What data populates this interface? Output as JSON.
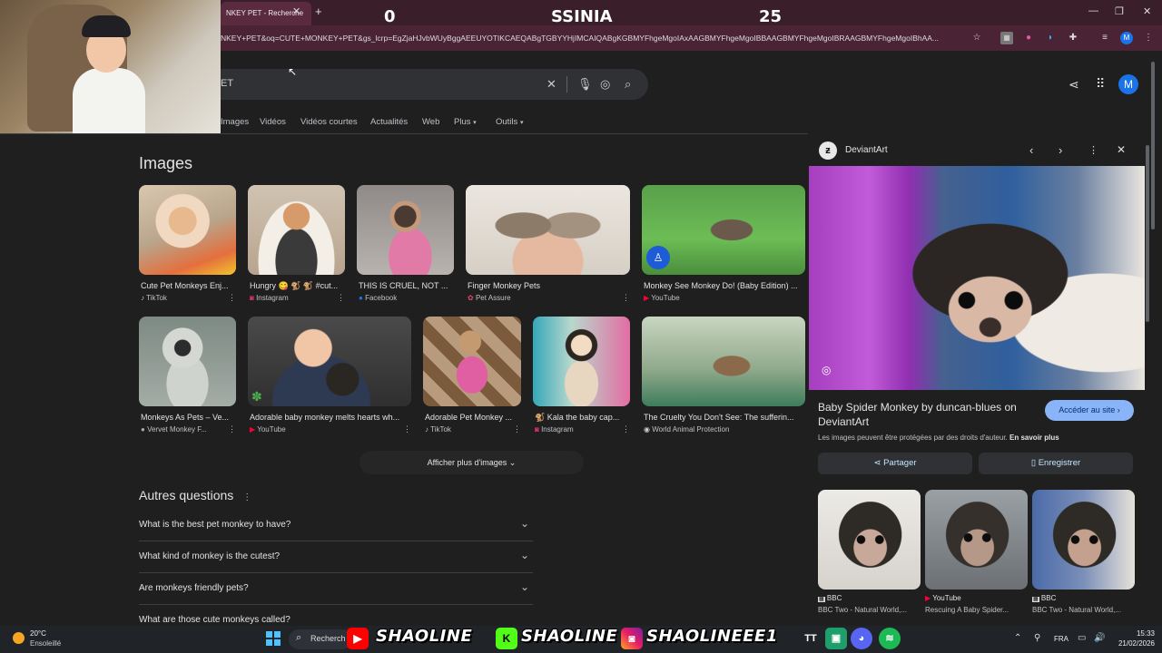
{
  "scoreboard": {
    "left": "0",
    "center": "SSINIA",
    "right": "25"
  },
  "browser": {
    "tab_title": "NKEY PET - Recherche",
    "url": "NKEY+PET&oq=CUTE+MONKEY+PET&gs_lcrp=EgZjaHJvbWUyBggAEEUYOTIKCAEQABgTGBYYHjIMCAIQABgKGBMYFhgeMgoIAxAAGBMYFhgeMgoIBBAAGBMYFhgeMgoIBRAAGBMYFhgeMgoIBhAA...",
    "close": "✕",
    "new_tab": "+",
    "win_min": "—",
    "win_max": "❐",
    "win_close": "✕"
  },
  "google": {
    "search_value": "ET",
    "filters": [
      "Images",
      "Vidéos",
      "Vidéos courtes",
      "Actualités",
      "Web",
      "Plus",
      "Outils"
    ],
    "avatar": "M"
  },
  "images": {
    "title": "Images",
    "more_label": "Afficher plus d'images",
    "items": [
      {
        "title": "Cute Pet Monkeys Enj...",
        "source": "TikTok"
      },
      {
        "title": "Hungry 😋 🐒 🐒 #cut...",
        "source": "Instagram"
      },
      {
        "title": "THIS IS CRUEL, NOT ...",
        "source": "Facebook"
      },
      {
        "title": "Finger Monkey Pets",
        "source": "Pet Assure"
      },
      {
        "title": "Monkey See Monkey Do! (Baby Edition) ...",
        "source": "YouTube"
      },
      {
        "title": "Monkeys As Pets – Ve...",
        "source": "Vervet Monkey F..."
      },
      {
        "title": "Adorable baby monkey melts hearts wh...",
        "source": "YouTube"
      },
      {
        "title": "Adorable Pet Monkey ...",
        "source": "TikTok"
      },
      {
        "title": "🐒 Kala the baby cap...",
        "source": "Instagram"
      },
      {
        "title": "The Cruelty You Don't See: The sufferin...",
        "source": "World Animal Protection"
      }
    ]
  },
  "questions": {
    "title": "Autres questions",
    "items": [
      "What is the best pet monkey to have?",
      "What kind of monkey is the cutest?",
      "Are monkeys friendly pets?",
      "What are those cute monkeys called?"
    ]
  },
  "panel": {
    "source": "DeviantArt",
    "title": "Baby Spider Monkey by duncan-blues on DeviantArt",
    "visit_label": "Accéder au site",
    "copyright": "Les images peuvent être protégées par des droits d'auteur.",
    "learn_more": "En savoir plus",
    "share_label": "Partager",
    "save_label": "Enregistrer",
    "related": [
      {
        "source": "BBC",
        "title": "BBC Two - Natural World,..."
      },
      {
        "source": "YouTube",
        "title": "Rescuing A Baby Spider..."
      },
      {
        "source": "BBC",
        "title": "BBC Two - Natural World,..."
      }
    ]
  },
  "taskbar": {
    "temp": "20°C",
    "weather": "Ensoleillé",
    "search": "Recherch",
    "social1": "SHAOLINE",
    "social2": "SHAOLINE",
    "social3": "SHAOLINEEE1",
    "lang": "FRA",
    "time": "15:33",
    "date": "21/02/2026"
  }
}
